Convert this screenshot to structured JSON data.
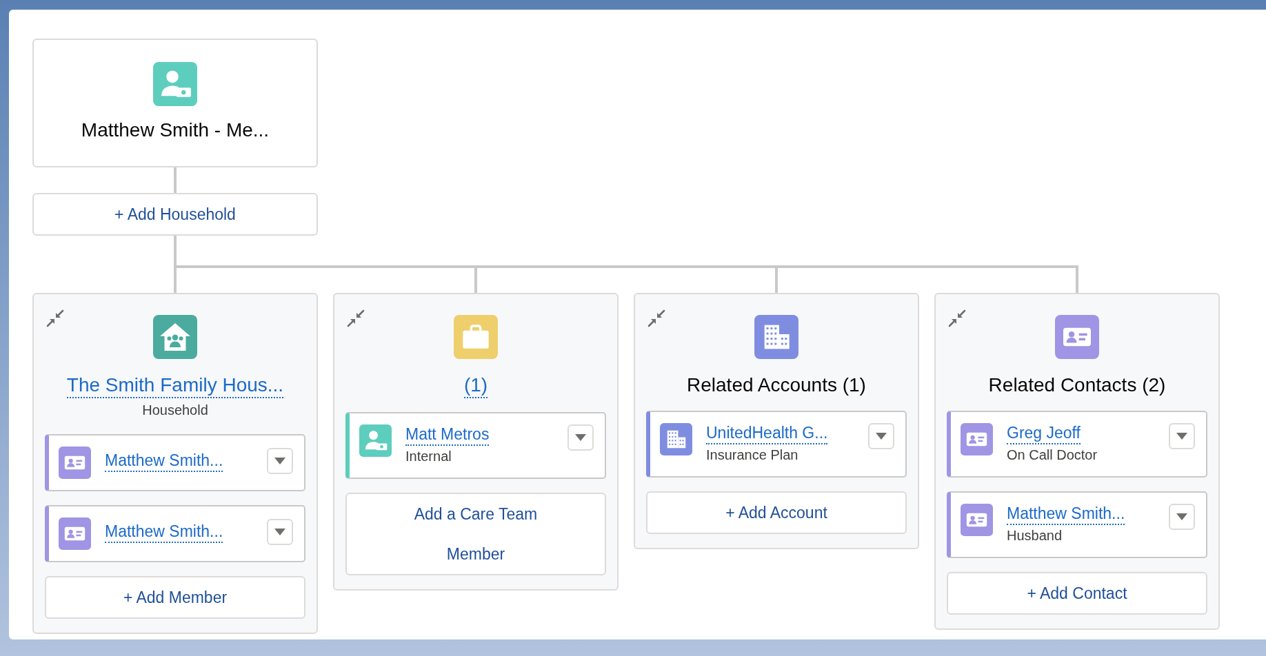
{
  "root": {
    "kind": "person-money",
    "title": "Matthew Smith - Me..."
  },
  "add_household": "+ Add Household",
  "groups": [
    {
      "kind": "household",
      "title": "The Smith Family Hous...",
      "title_is_link": true,
      "subtitle": "Household",
      "items": [
        {
          "kind": "contact",
          "name": "Matthew Smith..."
        },
        {
          "kind": "contact",
          "name": "Matthew Smith..."
        }
      ],
      "add": "+ Add Member"
    },
    {
      "kind": "briefcase",
      "title": "(1)",
      "title_is_link": true,
      "items": [
        {
          "kind": "person-money",
          "name": "Matt Metros",
          "role": "Internal"
        }
      ],
      "add": "Add a Care Team Member"
    },
    {
      "kind": "account",
      "title": "Related Accounts (1)",
      "title_is_link": false,
      "items": [
        {
          "kind": "account",
          "name": "UnitedHealth G...",
          "role": "Insurance Plan"
        }
      ],
      "add": "+ Add Account"
    },
    {
      "kind": "contact",
      "title": "Related Contacts (2)",
      "title_is_link": false,
      "items": [
        {
          "kind": "contact",
          "name": "Greg Jeoff",
          "role": "On Call Doctor"
        },
        {
          "kind": "contact",
          "name": "Matthew Smith...",
          "role": "Husband"
        }
      ],
      "add": "+ Add Contact"
    }
  ]
}
